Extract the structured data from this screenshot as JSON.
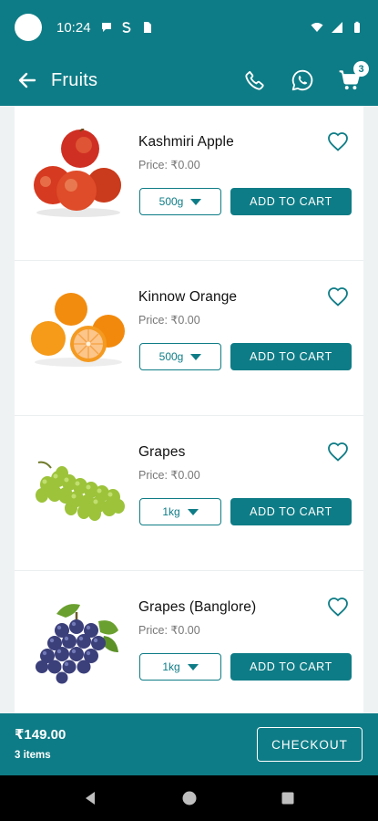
{
  "status_bar": {
    "time": "10:24"
  },
  "app_bar": {
    "title": "Fruits",
    "cart_count": "3"
  },
  "products": [
    {
      "name": "Kashmiri Apple",
      "price": "Price: ₹0.00",
      "quantity": "500g",
      "button": "ADD TO CART"
    },
    {
      "name": "Kinnow Orange",
      "price": "Price: ₹0.00",
      "quantity": "500g",
      "button": "ADD TO CART"
    },
    {
      "name": "Grapes",
      "price": "Price: ₹0.00",
      "quantity": "1kg",
      "button": "ADD TO CART"
    },
    {
      "name": "Grapes (Banglore)",
      "price": "Price: ₹0.00",
      "quantity": "1kg",
      "button": "ADD TO CART"
    }
  ],
  "bottom_bar": {
    "total": "₹149.00",
    "items": "3 items",
    "checkout_label": "CHECKOUT"
  },
  "colors": {
    "primary": "#0e7c86",
    "background": "#eef2f3"
  },
  "icons": [
    "back-arrow-icon",
    "phone-icon",
    "whatsapp-icon",
    "cart-icon",
    "heart-outline-icon",
    "dropdown-arrow-icon"
  ]
}
